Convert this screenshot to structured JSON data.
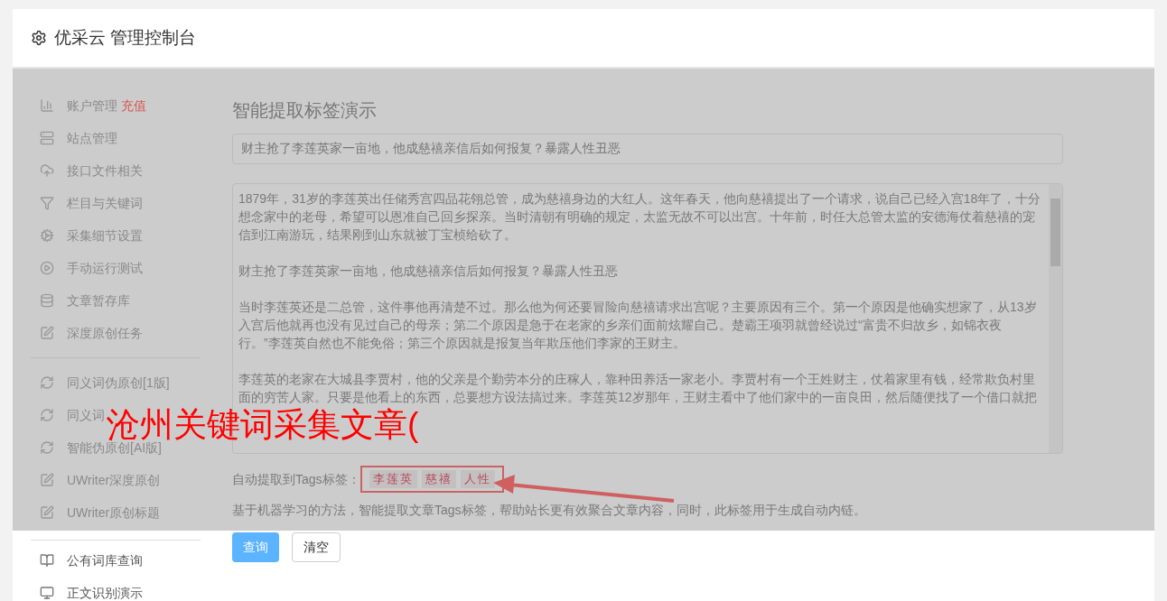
{
  "header": {
    "title": "优采云 管理控制台"
  },
  "sidebar": {
    "groups": [
      [
        {
          "label": "账户管理",
          "badge": "充值"
        },
        {
          "label": "站点管理"
        },
        {
          "label": "接口文件相关"
        },
        {
          "label": "栏目与关键词"
        },
        {
          "label": "采集细节设置"
        },
        {
          "label": "手动运行测试"
        },
        {
          "label": "文章暂存库"
        },
        {
          "label": "深度原创任务"
        }
      ],
      [
        {
          "label": "同义词伪原创[1版]"
        },
        {
          "label": "同义词"
        },
        {
          "label": "智能伪原创[AI版]"
        },
        {
          "label": "UWriter深度原创"
        },
        {
          "label": "UWriter原创标题"
        }
      ],
      [
        {
          "label": "公有词库查询"
        },
        {
          "label": "正文识别演示"
        }
      ]
    ]
  },
  "main": {
    "title": "智能提取标签演示",
    "title_field": {
      "value": "财主抢了李莲英家一亩地，他成慈禧亲信后如何报复？暴露人性丑恶"
    },
    "article": [
      "1879年，31岁的李莲英出任储秀宫四品花翎总管，成为慈禧身边的大红人。这年春天，他向慈禧提出了一个请求，说自己已经入宫18年了，十分想念家中的老母，希望可以恩准自己回乡探亲。当时清朝有明确的规定，太监无故不可以出宫。十年前，时任大总管太监的安德海仗着慈禧的宠信到江南游玩，结果刚到山东就被丁宝桢给砍了。",
      "财主抢了李莲英家一亩地，他成慈禧亲信后如何报复？暴露人性丑恶",
      "当时李莲英还是二总管，这件事他再清楚不过。那么他为何还要冒险向慈禧请求出宫呢？主要原因有三个。第一个原因是他确实想家了，从13岁入宫后他就再也没有见过自己的母亲；第二个原因是急于在老家的乡亲们面前炫耀自己。楚霸王项羽就曾经说过“富贵不归故乡，如锦衣夜行。”李莲英自然也不能免俗；第三个原因就是报复当年欺压他们李家的王财主。",
      "李莲英的老家在大城县李贾村，他的父亲是个勤劳本分的庄稼人，靠种田养活一家老小。李贾村有一个王姓财主，仗着家里有钱，经常欺负村里面的穷苦人家。只要是他看上的东西，总要想方设法搞过来。李莲英12岁那年，王财主看中了他们家中的一亩良田，然后随便找了一个借口就把"
    ],
    "tags_label": "自动提取到Tags标签：",
    "tags": [
      "李莲英",
      "慈禧",
      "人性"
    ],
    "description": "基于机器学习的方法，智能提取文章Tags标签，帮助站长更有效聚合文章内容，同时，此标签用于生成自动内链。",
    "buttons": [
      {
        "label": "查询",
        "kind": "primary"
      },
      {
        "label": "清空",
        "kind": "default"
      }
    ]
  },
  "annotation": {
    "text": "沧州关键词采集文章("
  }
}
